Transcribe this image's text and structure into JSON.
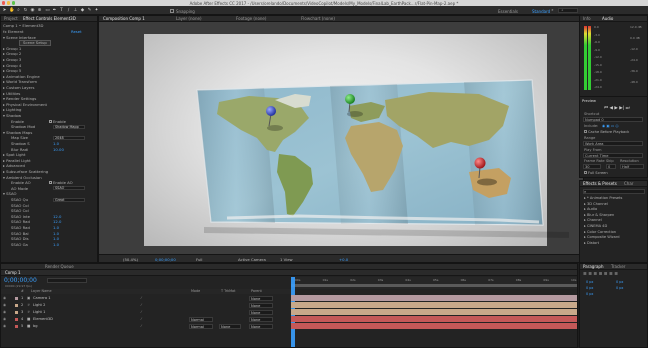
{
  "window": {
    "title": "Adobe After Effects CC 2017 - /Users/orelando/Documents/VideoCopilot/Models/My_Models/FinalLab_EarthPack...r/Flat-Pin-Map-2.aep *"
  },
  "toolbar": {
    "snapping_label": "Snapping",
    "workspaces": [
      "Essentials",
      "Standard"
    ],
    "active_workspace": "Standard"
  },
  "effect_controls": {
    "tabs": [
      "Project",
      "Effect Controls Element3D"
    ],
    "active_tab": "Effect Controls Element3D",
    "layer_path": "Comp 1 • Element3D",
    "rows": [
      {
        "label": "fx Element",
        "reset": "Reset"
      },
      {
        "label": "▾ Scene Interface"
      },
      {
        "label": "Scene Setup",
        "button": true
      },
      {
        "label": "▸ Group 1"
      },
      {
        "label": "▸ Group 2"
      },
      {
        "label": "▸ Group 3"
      },
      {
        "label": "▸ Group 4"
      },
      {
        "label": "▸ Group 5"
      },
      {
        "label": "▸ Animation Engine"
      },
      {
        "label": "▸ World Transform"
      },
      {
        "label": "▸ Custom Layers"
      },
      {
        "label": "▸ Utilities"
      },
      {
        "label": "▾ Render Settings"
      },
      {
        "label": "▸ Physical Environment"
      },
      {
        "label": "▸ Lighting"
      },
      {
        "label": "▾ Shadow"
      },
      {
        "label": "Enable",
        "checkbox2": "Enable"
      },
      {
        "label": "Shadow Mod",
        "box": "Shadow Mapp"
      },
      {
        "label": "▾ Shadow Maps"
      },
      {
        "label": "Map Size",
        "box": "2048"
      },
      {
        "label": "Shadow S",
        "value": "1.0"
      },
      {
        "label": "Blur Radi",
        "value": "10.00"
      },
      {
        "label": "▸ Spot Light"
      },
      {
        "label": "▸ Parallel Light"
      },
      {
        "label": "▸ Advanced"
      },
      {
        "label": "▸ Subsurface Scattering"
      },
      {
        "label": "▾ Ambient Occlusion"
      },
      {
        "label": "Enable AO",
        "checkbox2": "Enable AO"
      },
      {
        "label": "AO Mode",
        "box": "SSAO"
      },
      {
        "label": "▾ SSAO"
      },
      {
        "label": "SSAO Qu",
        "box": "Great"
      },
      {
        "label": "SSAO Col"
      },
      {
        "label": "SSAO Col"
      },
      {
        "label": "SSAO Inte",
        "value": "12.0"
      },
      {
        "label": "SSAO Rad",
        "value": "12.0"
      },
      {
        "label": "SSAO Rad",
        "value": "1.0"
      },
      {
        "label": "SSAO Bal",
        "value": "1.0"
      },
      {
        "label": "SSAO Dis",
        "value": "1.0"
      },
      {
        "label": "SSAO Ga",
        "value": "1.0"
      }
    ]
  },
  "viewer": {
    "tabs": [
      "Composition Comp 1",
      "Layer (none)",
      "Footage (none)",
      "Flowchart (none)"
    ],
    "active_tab": "Composition Comp 1",
    "comp_button": "Comp 1",
    "renderer": "Renderer:",
    "renderer_value": "Classic 3D"
  },
  "viewer_footer": {
    "zoom": "(50.4%)",
    "timecode": "0;00;00;00",
    "resolution": "Full",
    "camera": "Active Camera",
    "views": "1 View",
    "exposure": "+0.0"
  },
  "info_panel": {
    "tabs": [
      "Info",
      "Audio"
    ],
    "active_tab": "Audio",
    "db_labels": [
      "0.0",
      "-3.0",
      "-6.0",
      "-9.0",
      "-12.0",
      "-15.0",
      "-18.0",
      "-21.0",
      "-24.0"
    ],
    "db_labels_right": [
      "12.0 dB",
      "0.0 dB",
      "-12.0",
      "-24.0",
      "-36.0",
      "-48.0"
    ]
  },
  "preview_panel": {
    "title": "Preview",
    "shortcut_label": "Shortcut",
    "shortcut_value": "Numpad 0",
    "include_label": "Include:",
    "cache_label": "Cache Before Playback",
    "range_label": "Range",
    "range_value": "Work Area",
    "play_from_label": "Play From",
    "play_from_value": "Current Time",
    "frame_rate_label": "Frame Rate",
    "skip_label": "Skip",
    "resolution_label": "Resolution",
    "frame_rate_value": "30",
    "skip_value": "0",
    "resolution_value": "Half",
    "full_screen": "Full Screen"
  },
  "effects_presets": {
    "tabs": [
      "Effects & Presets",
      "Char"
    ],
    "active_tab": "Effects & Presets",
    "search_placeholder": "",
    "items": [
      "▸ * Animation Presets",
      "▸ 3D Channel",
      "▸ Audio",
      "▸ Blur & Sharpen",
      "▸ Channel",
      "▸ CINEMA 4D",
      "▸ Color Correction",
      "▸ Composite Wizard",
      "▸ Distort"
    ]
  },
  "paragraph_panel": {
    "tabs": [
      "Paragraph",
      "Tracker"
    ],
    "active_tab": "Paragraph",
    "values": [
      "0 px",
      "0 px",
      "0 px",
      "0 px",
      "0 px"
    ]
  },
  "timeline": {
    "render_queue_tab": "Render Queue",
    "comp_tab": "Comp 1",
    "timecode": "0;00;00;00",
    "frame_info": "00000 (29.97 fps)",
    "search_placeholder": "",
    "columns": [
      "#",
      "Layer Name",
      "Mode",
      "T TrkMat",
      "Parent"
    ],
    "layers": [
      {
        "num": "1",
        "name": "Camera 1",
        "parent": "None",
        "color": "#b59aa0",
        "icon": "camera-icon"
      },
      {
        "num": "2",
        "name": "Light 2",
        "parent": "None",
        "color": "#c8a88a",
        "icon": "light-icon"
      },
      {
        "num": "3",
        "name": "Light 1",
        "parent": "None",
        "color": "#c8a88a",
        "icon": "light-icon"
      },
      {
        "num": "4",
        "name": "Element3D",
        "mode": "Normal",
        "parent": "None",
        "color": "#c45858",
        "icon": "solid-icon"
      },
      {
        "num": "5",
        "name": "bg",
        "mode": "Normal",
        "trkmat": "None",
        "parent": "None",
        "color": "#c45858",
        "icon": "solid-icon"
      }
    ],
    "ruler_ticks": [
      "00s",
      "01s",
      "02s",
      "03s",
      "04s",
      "05s",
      "06s",
      "07s",
      "08s",
      "09s",
      "10s"
    ]
  }
}
